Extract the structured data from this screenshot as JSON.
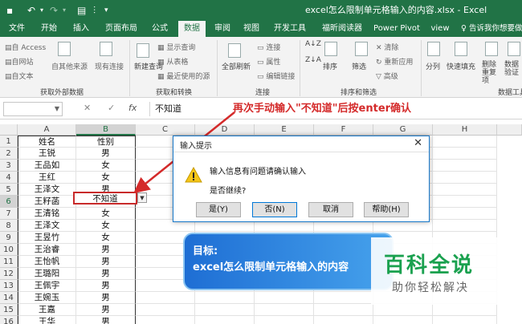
{
  "window": {
    "title": "excel怎么限制单元格输入的内容.xlsx - Excel",
    "quick_access": [
      "save-icon",
      "undo-icon",
      "redo-icon",
      "form-icon",
      "customize-icon"
    ]
  },
  "tabs": [
    "文件",
    "开始",
    "插入",
    "页面布局",
    "公式",
    "数据",
    "审阅",
    "视图",
    "开发工具",
    "福昕阅读器",
    "Power Pivot",
    "view"
  ],
  "active_tab": "数据",
  "tell_me": "告诉我你想要做",
  "ribbon": {
    "external": {
      "access": "自 Access",
      "web": "自网站",
      "text": "自文本",
      "other": "自其他来源",
      "existing": "现有连接",
      "group": "获取外部数据"
    },
    "transform": {
      "new_query": "新建查询",
      "show_query": "显示查询",
      "from_table": "从表格",
      "recent": "最近使用的源",
      "group": "获取和转换"
    },
    "connections": {
      "refresh_all": "全部刷新",
      "connections": "连接",
      "properties": "属性",
      "edit_links": "编辑链接",
      "group": "连接"
    },
    "sort_filter": {
      "sort": "排序",
      "filter": "筛选",
      "clear": "清除",
      "reapply": "重新应用",
      "advanced": "高级",
      "group": "排序和筛选"
    },
    "tools": {
      "split": "分列",
      "flash_fill": "快速填充",
      "remove_dup": "删除重复项",
      "validation": "数据验证",
      "group": "数据工具"
    }
  },
  "formula_bar": {
    "cancel": "✕",
    "enter": "✓",
    "fx": "fx",
    "value": "不知道"
  },
  "annotation": "再次手动输入\"不知道\"后按enter确认",
  "columns": [
    "A",
    "B",
    "C",
    "D",
    "E",
    "F",
    "G",
    "H"
  ],
  "rows": [
    {
      "n": "1",
      "a": "姓名",
      "b": "性别"
    },
    {
      "n": "2",
      "a": "王锐",
      "b": "男"
    },
    {
      "n": "3",
      "a": "王品如",
      "b": "女"
    },
    {
      "n": "4",
      "a": "王红",
      "b": "女"
    },
    {
      "n": "5",
      "a": "王泽文",
      "b": "男"
    },
    {
      "n": "6",
      "a": "王籽菡",
      "b": "不知道"
    },
    {
      "n": "7",
      "a": "王清铭",
      "b": "女"
    },
    {
      "n": "8",
      "a": "王泽文",
      "b": "女"
    },
    {
      "n": "9",
      "a": "王昱竹",
      "b": "女"
    },
    {
      "n": "10",
      "a": "王治睿",
      "b": "男"
    },
    {
      "n": "11",
      "a": "王怡帆",
      "b": "男"
    },
    {
      "n": "12",
      "a": "王璐阳",
      "b": "男"
    },
    {
      "n": "13",
      "a": "王佩宇",
      "b": "男"
    },
    {
      "n": "14",
      "a": "王婉玉",
      "b": "男"
    },
    {
      "n": "15",
      "a": "王嘉",
      "b": "男"
    },
    {
      "n": "16",
      "a": "王华",
      "b": "男"
    }
  ],
  "dialog": {
    "title": "输入提示",
    "message": "输入信息有问题请确认输入",
    "question": "是否继续?",
    "buttons": [
      "是(Y)",
      "否(N)",
      "取消",
      "帮助(H)"
    ]
  },
  "goal": {
    "label": "目标:",
    "text": "excel怎么限制单元格输入的内容"
  },
  "watermark": {
    "brand": "百科全说",
    "slogan": "助你轻松解决"
  },
  "colors": {
    "excel_green": "#217346",
    "annotation_red": "#d42a2a",
    "goal_blue": "#2a7ee0",
    "watermark_green": "#1aa14f"
  }
}
